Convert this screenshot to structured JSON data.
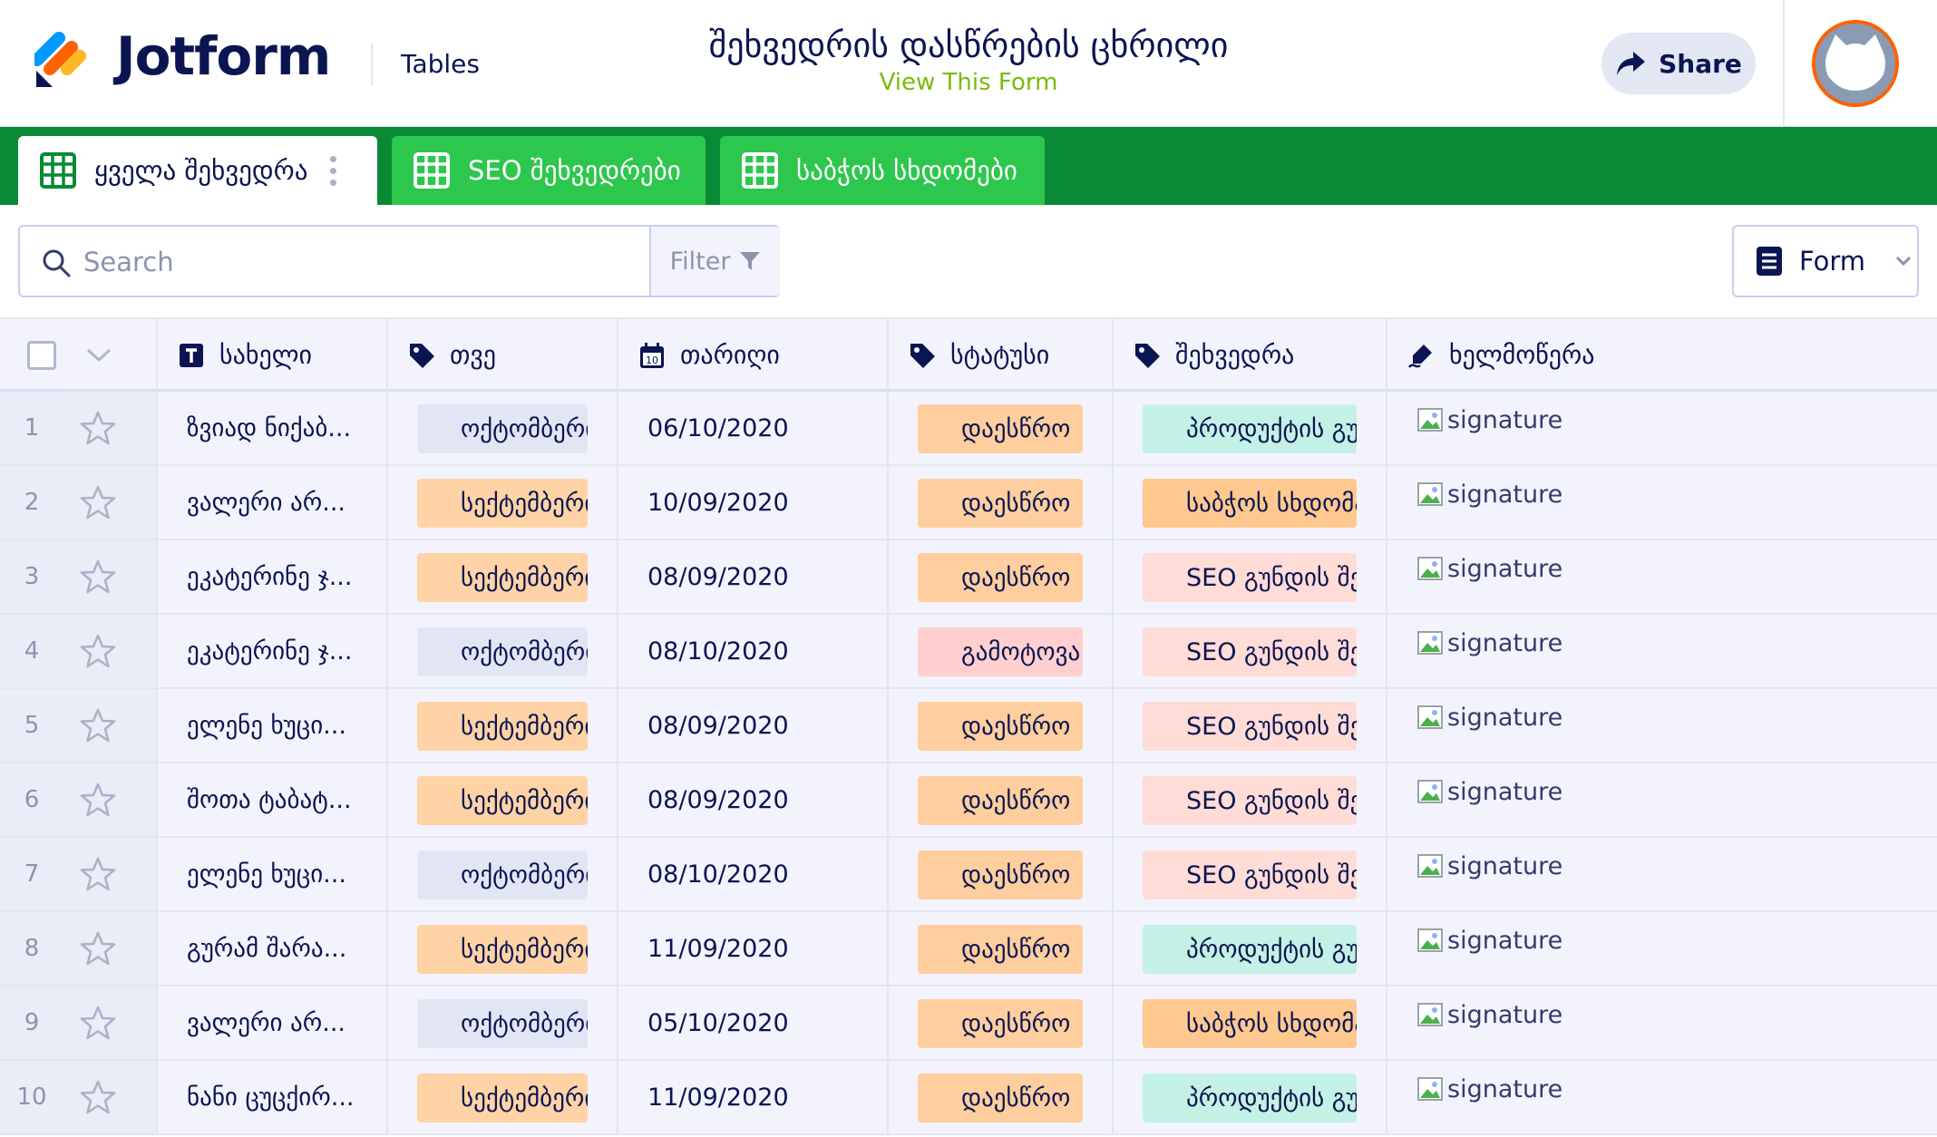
{
  "header": {
    "brand": "Jotform",
    "section": "Tables",
    "form_title": "შეხვედრის დასწრების ცხრილი",
    "view_form": "View This Form",
    "share_label": "Share"
  },
  "tabs": [
    {
      "label": "ყველა შეხვედრა",
      "active": true
    },
    {
      "label": "SEO შეხვედრები",
      "active": false
    },
    {
      "label": "საბჭოს სხდომები",
      "active": false
    }
  ],
  "toolbar": {
    "search_placeholder": "Search",
    "filter_label": "Filter",
    "view_label": "Form"
  },
  "columns": [
    {
      "label": "სახელი",
      "icon": "text-icon"
    },
    {
      "label": "თვე",
      "icon": "tag-icon"
    },
    {
      "label": "თარიღი",
      "icon": "calendar-icon",
      "icon_text": "10"
    },
    {
      "label": "სტატუსი",
      "icon": "tag-icon"
    },
    {
      "label": "შეხვედრა",
      "icon": "tag-icon"
    },
    {
      "label": "ხელმოწერა",
      "icon": "signature-pen-icon"
    }
  ],
  "rows": [
    {
      "index": "1",
      "name": "ზვიად ნიქაბ...",
      "month": "ოქტომბერი",
      "date": "06/10/2020",
      "status": "დაესწრო",
      "meeting": "პროდუქტის გუნდის შეხვედრა",
      "signature": "signature"
    },
    {
      "index": "2",
      "name": "ვალერი არ...",
      "month": "სექტემბერი",
      "date": "10/09/2020",
      "status": "დაესწრო",
      "meeting": "საბჭოს სხდომა",
      "signature": "signature"
    },
    {
      "index": "3",
      "name": "ეკატერინე ჯ...",
      "month": "სექტემბერი",
      "date": "08/09/2020",
      "status": "დაესწრო",
      "meeting": "SEO გუნდის შეხვედრა",
      "signature": "signature"
    },
    {
      "index": "4",
      "name": "ეკატერინე ჯ...",
      "month": "ოქტომბერი",
      "date": "08/10/2020",
      "status": "გამოტოვა",
      "meeting": "SEO გუნდის შეხვედრა",
      "signature": "signature"
    },
    {
      "index": "5",
      "name": "ელენე ხუცი...",
      "month": "სექტემბერი",
      "date": "08/09/2020",
      "status": "დაესწრო",
      "meeting": "SEO გუნდის შეხვედრა",
      "signature": "signature"
    },
    {
      "index": "6",
      "name": "შოთა ტაბატ...",
      "month": "სექტემბერი",
      "date": "08/09/2020",
      "status": "დაესწრო",
      "meeting": "SEO გუნდის შეხვედრა",
      "signature": "signature"
    },
    {
      "index": "7",
      "name": "ელენე ხუცი...",
      "month": "ოქტომბერი",
      "date": "08/10/2020",
      "status": "დაესწრო",
      "meeting": "SEO გუნდის შეხვედრა",
      "signature": "signature"
    },
    {
      "index": "8",
      "name": "გურამ შარა...",
      "month": "სექტემბერი",
      "date": "11/09/2020",
      "status": "დაესწრო",
      "meeting": "პროდუქტის გუნდის შეხვედრა",
      "signature": "signature"
    },
    {
      "index": "9",
      "name": "ვალერი არ...",
      "month": "ოქტომბერი",
      "date": "05/10/2020",
      "status": "დაესწრო",
      "meeting": "საბჭოს სხდომა",
      "signature": "signature"
    },
    {
      "index": "10",
      "name": "ნანი ცუცქირ...",
      "month": "სექტემბერი",
      "date": "11/09/2020",
      "status": "დაესწრო",
      "meeting": "პროდუქტის გუნდის შეხვედრა",
      "signature": "signature"
    }
  ],
  "colors": {
    "brand_navy": "#0a1551",
    "tabbar_green": "#098935",
    "tab_green": "#2dc74e",
    "view_form_green": "#78bb07",
    "month_oct": "#e2e5f4",
    "month_sep": "#ffd3a5",
    "status_attended": "#ffce9e",
    "status_missed": "#ffcfcf",
    "meeting_product": "#c4f1e5",
    "meeting_board": "#ffc88f",
    "meeting_seo": "#ffdcd6"
  }
}
